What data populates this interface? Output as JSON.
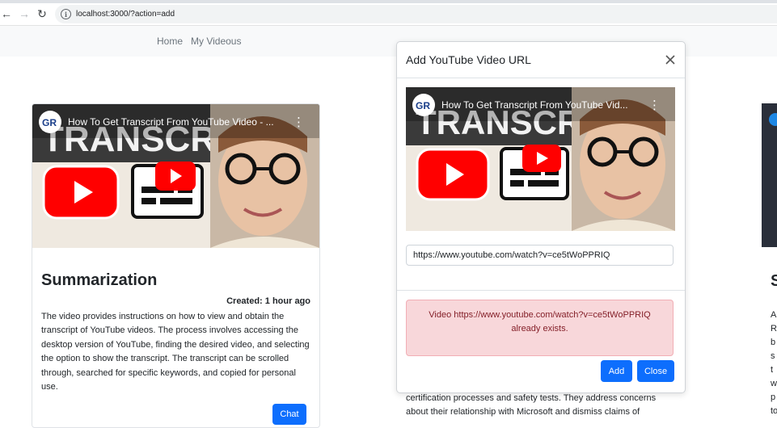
{
  "browser": {
    "back_glyph": "←",
    "forward_glyph": "→",
    "reload_glyph": "↻",
    "info_glyph": "i",
    "url": "localhost:3000/?action=add"
  },
  "navbar": {
    "links": [
      "Home",
      "My Videous"
    ]
  },
  "video": {
    "title": "How To Get Transcript From YouTube Video - ...",
    "title_modal": "How To Get Transcript From YouTube Vid...",
    "banner_text": "TRANSCRIPT",
    "channel_logo_text": "GR",
    "menu_glyph": "⋮"
  },
  "card1": {
    "title": "Summarization",
    "created": "Created: 1 hour ago",
    "description": "The video provides instructions on how to view and obtain the transcript of YouTube videos. The process involves accessing the desktop version of YouTube, finding the desired video, and selecting the option to show the transcript. The transcript can be scrolled through, searched for specific keywords, and copied for personal use.",
    "chat_label": "Chat"
  },
  "right_card": {
    "title_fragment": "S",
    "text_fragments": [
      "A",
      "R",
      "b",
      "s",
      "t",
      "w",
      "p",
      "to"
    ]
  },
  "behind_modal_text": [
    "certification processes and safety tests. They address concerns",
    "about their relationship with Microsoft and dismiss claims of"
  ],
  "modal": {
    "title": "Add YouTube Video URL",
    "url_value": "https://www.youtube.com/watch?v=ce5tWoPPRIQ",
    "alert_line1": "Video https://www.youtube.com/watch?v=ce5tWoPPRIQ",
    "alert_line2": "already exists.",
    "add_label": "Add",
    "close_label": "Close"
  },
  "colors": {
    "primary": "#0d6efd",
    "alert_bg": "#f8d7da",
    "alert_text": "#842029",
    "youtube_red": "#ff0000"
  }
}
